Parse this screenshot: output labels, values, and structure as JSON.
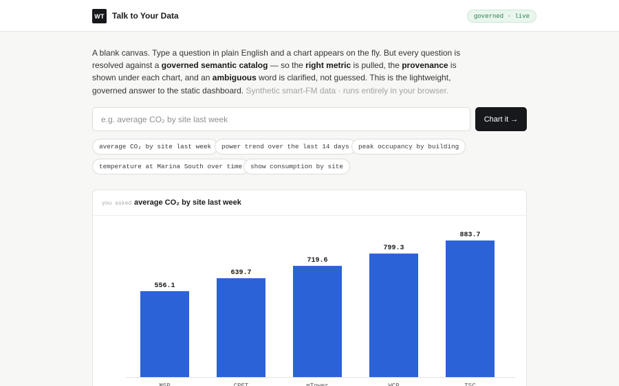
{
  "header": {
    "logo": "WT",
    "title": "Talk to Your Data",
    "status": "governed · live"
  },
  "intro": {
    "t1": "A blank canvas. Type a question in plain English and a chart appears on the fly. But every question is resolved against a ",
    "b1": "governed semantic catalog",
    "t2": " — so the ",
    "b2": "right metric",
    "t3": " is pulled, the ",
    "b3": "provenance",
    "t4": " is shown under each chart, and an ",
    "b4": "ambiguous",
    "t5": " word is clarified, not guessed. This is the lightweight, governed answer to the static dashboard. ",
    "muted": "Synthetic smart-FM data · runs entirely in your browser."
  },
  "query": {
    "placeholder": "e.g. average CO₂ by site last week",
    "value": "",
    "button_label": "Chart it →"
  },
  "suggestions": [
    "average CO₂ by site last week",
    "power trend over the last 14 days",
    "peak occupancy by building",
    "temperature at Marina South over time",
    "show consumption by site"
  ],
  "result": {
    "asked_label": "you asked",
    "question": "average CO₂ by site last week"
  },
  "colors": {
    "bar": "#2b62d6",
    "ink": "#16181b",
    "live_bg": "#e9f6ee",
    "live_text": "#2e7d4f"
  },
  "chart_data": {
    "type": "bar",
    "categories": [
      "MSP",
      "CPET",
      "mTower",
      "WCP",
      "TSC"
    ],
    "values": [
      556.1,
      639.7,
      719.6,
      799.3,
      883.7
    ],
    "value_labels": [
      "556.1",
      "639.7",
      "719.6",
      "799.3",
      "883.7"
    ],
    "title": "",
    "xlabel": "",
    "ylabel": "",
    "ylim": [
      0,
      1000
    ],
    "grid": false,
    "legend": "none"
  }
}
